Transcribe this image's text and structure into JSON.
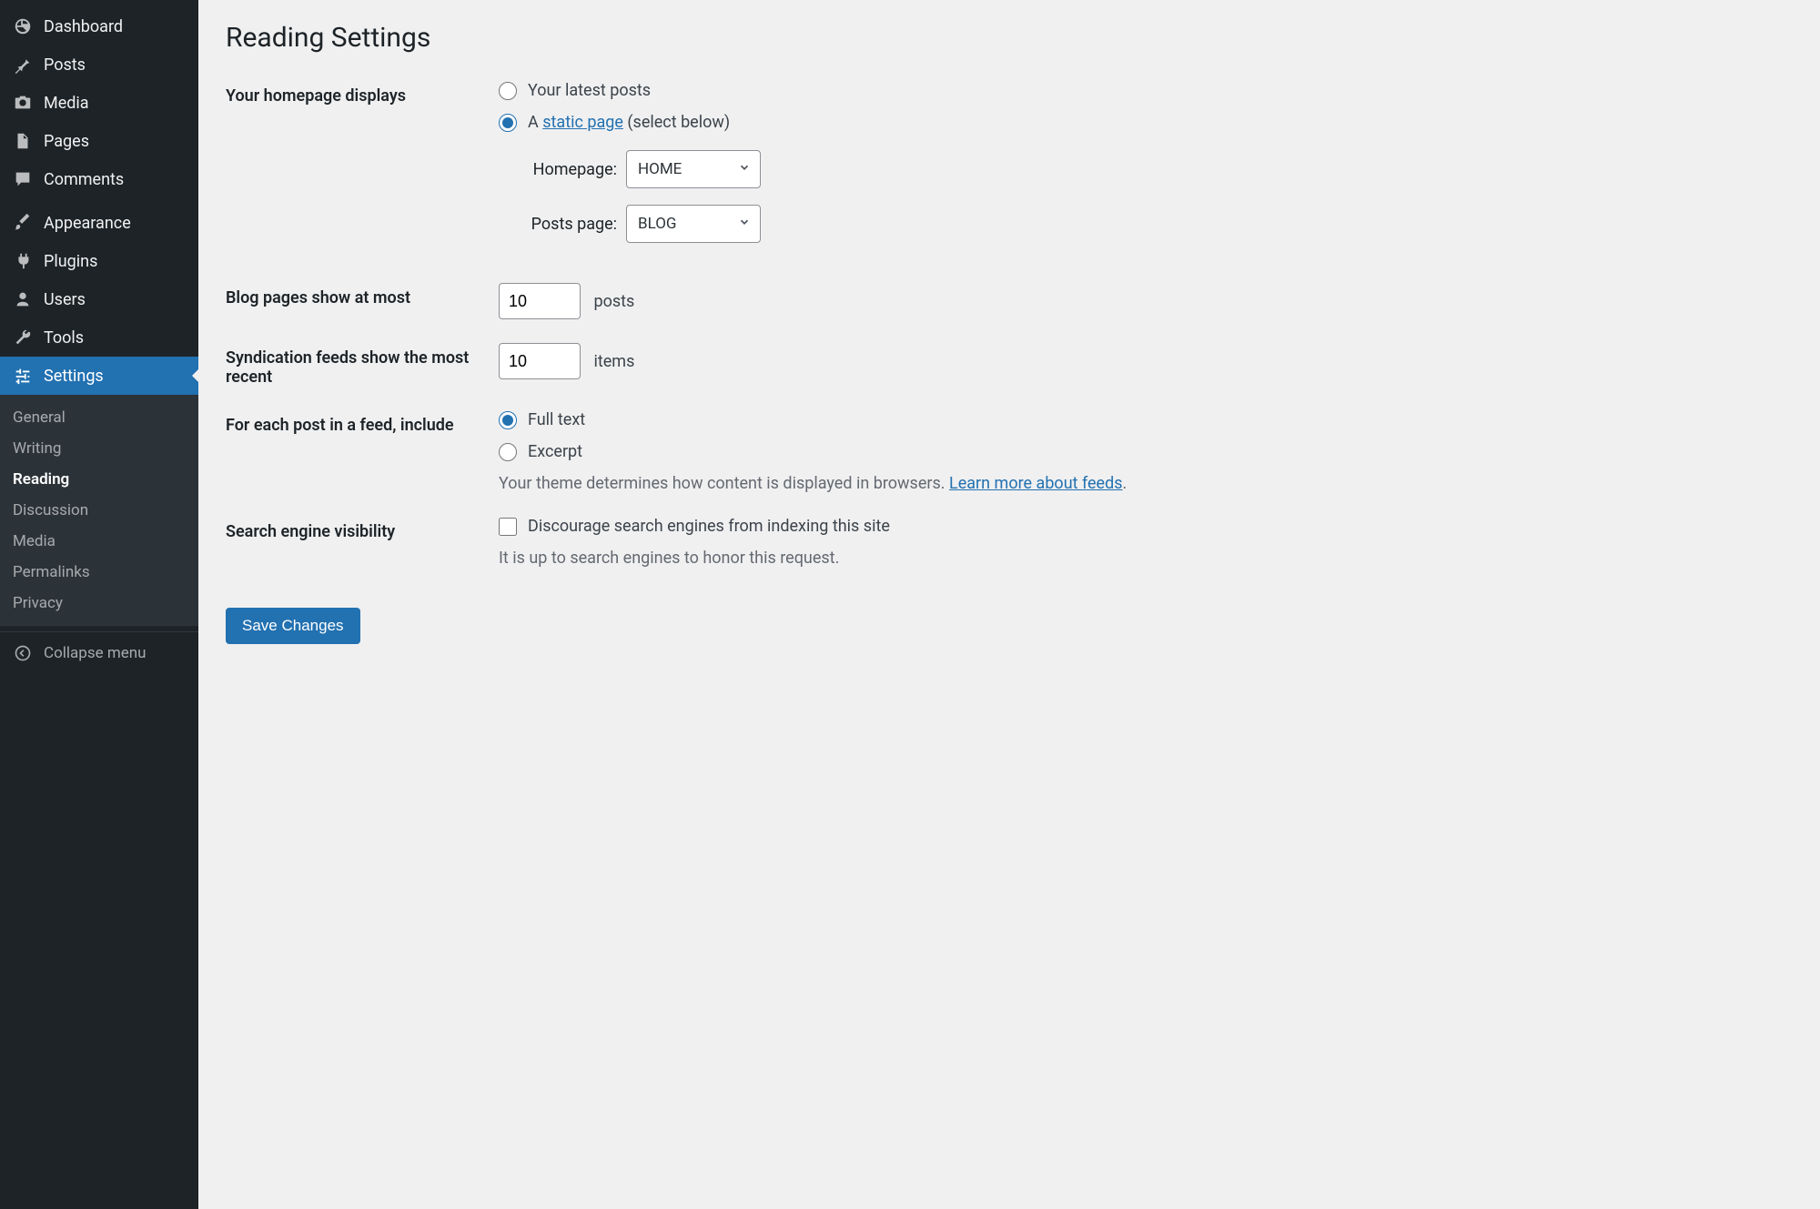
{
  "sidebar": {
    "items": [
      {
        "label": "Dashboard",
        "icon": "dashboard"
      },
      {
        "label": "Posts",
        "icon": "pin"
      },
      {
        "label": "Media",
        "icon": "camera"
      },
      {
        "label": "Pages",
        "icon": "page"
      },
      {
        "label": "Comments",
        "icon": "comment"
      },
      {
        "label": "Appearance",
        "icon": "brush"
      },
      {
        "label": "Plugins",
        "icon": "plug"
      },
      {
        "label": "Users",
        "icon": "user"
      },
      {
        "label": "Tools",
        "icon": "wrench"
      },
      {
        "label": "Settings",
        "icon": "sliders"
      }
    ],
    "submenu_settings": [
      "General",
      "Writing",
      "Reading",
      "Discussion",
      "Media",
      "Permalinks",
      "Privacy"
    ],
    "collapse": "Collapse menu"
  },
  "page": {
    "title": "Reading Settings",
    "homepage_displays": {
      "label": "Your homepage displays",
      "option_latest": "Your latest posts",
      "option_static_prefix": "A ",
      "option_static_link": "static page",
      "option_static_suffix": " (select below)",
      "homepage_label": "Homepage:",
      "homepage_value": "HOME",
      "postspage_label": "Posts page:",
      "postspage_value": "BLOG"
    },
    "blog_pages": {
      "label": "Blog pages show at most",
      "value": "10",
      "unit": "posts"
    },
    "syndication": {
      "label": "Syndication feeds show the most recent",
      "value": "10",
      "unit": "items"
    },
    "feed_include": {
      "label": "For each post in a feed, include",
      "option_full": "Full text",
      "option_excerpt": "Excerpt",
      "desc_prefix": "Your theme determines how content is displayed in browsers. ",
      "desc_link": "Learn more about feeds",
      "desc_suffix": "."
    },
    "search_vis": {
      "label": "Search engine visibility",
      "checkbox_label": "Discourage search engines from indexing this site",
      "desc": "It is up to search engines to honor this request."
    },
    "save_button": "Save Changes"
  }
}
